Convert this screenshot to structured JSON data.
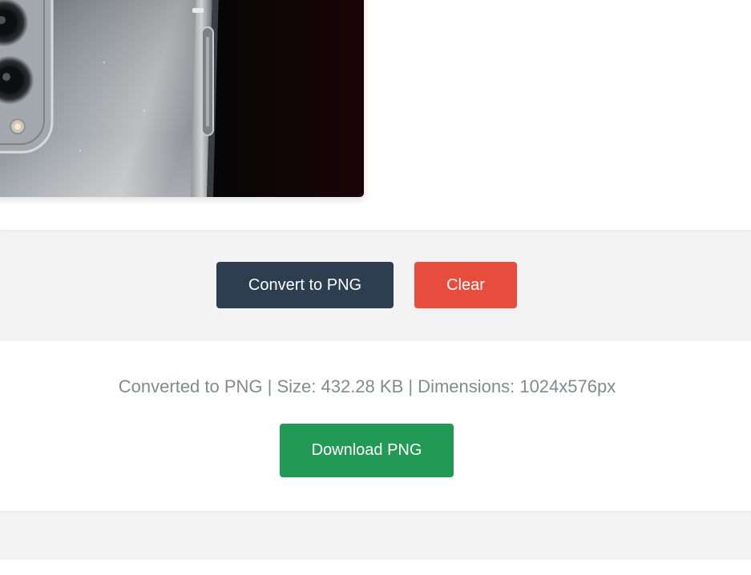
{
  "preview": {
    "image_subject": "smartphone-camera-photo"
  },
  "actions": {
    "convert_label": "Convert to PNG",
    "clear_label": "Clear"
  },
  "result": {
    "info_text": "Converted to PNG | Size: 432.28 KB | Dimensions: 1024x576px",
    "download_label": "Download PNG"
  },
  "colors": {
    "convert_button": "#2c3e50",
    "clear_button": "#e74c3c",
    "download_button": "#229954",
    "info_text": "#7f8c8d",
    "section_background": "#f3f3f3"
  }
}
